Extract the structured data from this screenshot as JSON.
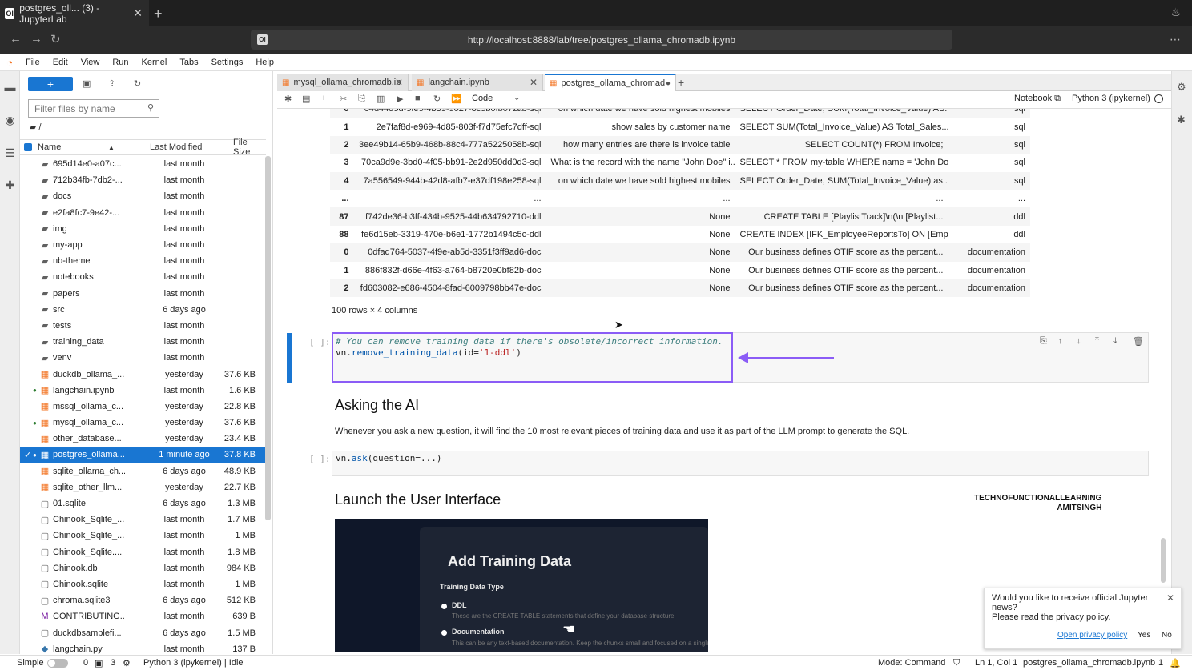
{
  "browser": {
    "tab_title": "postgres_oll... (3) - JupyterLab",
    "tab_favicon": "Ol",
    "url": "http://localhost:8888/lab/tree/postgres_ollama_chromadb.ipynb"
  },
  "menu": [
    "File",
    "Edit",
    "View",
    "Run",
    "Kernel",
    "Tabs",
    "Settings",
    "Help"
  ],
  "filebrowser": {
    "filter_placeholder": "Filter files by name",
    "breadcrumb": "/",
    "columns": {
      "name": "Name",
      "modified": "Last Modified",
      "size": "File Size"
    },
    "files": [
      {
        "icon": "folder-icon",
        "name": "695d14e0-a07c...",
        "modified": "last month",
        "size": "",
        "running": false,
        "selected": false
      },
      {
        "icon": "folder-icon",
        "name": "712b34fb-7db2-...",
        "modified": "last month",
        "size": "",
        "running": false,
        "selected": false
      },
      {
        "icon": "folder-icon",
        "name": "docs",
        "modified": "last month",
        "size": "",
        "running": false,
        "selected": false
      },
      {
        "icon": "folder-icon",
        "name": "e2fa8fc7-9e42-...",
        "modified": "last month",
        "size": "",
        "running": false,
        "selected": false
      },
      {
        "icon": "folder-icon",
        "name": "img",
        "modified": "last month",
        "size": "",
        "running": false,
        "selected": false
      },
      {
        "icon": "folder-icon",
        "name": "my-app",
        "modified": "last month",
        "size": "",
        "running": false,
        "selected": false
      },
      {
        "icon": "folder-icon",
        "name": "nb-theme",
        "modified": "last month",
        "size": "",
        "running": false,
        "selected": false
      },
      {
        "icon": "folder-icon",
        "name": "notebooks",
        "modified": "last month",
        "size": "",
        "running": false,
        "selected": false
      },
      {
        "icon": "folder-icon",
        "name": "papers",
        "modified": "last month",
        "size": "",
        "running": false,
        "selected": false
      },
      {
        "icon": "folder-icon",
        "name": "src",
        "modified": "6 days ago",
        "size": "",
        "running": false,
        "selected": false
      },
      {
        "icon": "folder-icon",
        "name": "tests",
        "modified": "last month",
        "size": "",
        "running": false,
        "selected": false
      },
      {
        "icon": "folder-icon",
        "name": "training_data",
        "modified": "last month",
        "size": "",
        "running": false,
        "selected": false
      },
      {
        "icon": "folder-icon",
        "name": "venv",
        "modified": "last month",
        "size": "",
        "running": false,
        "selected": false
      },
      {
        "icon": "notebook-icon",
        "name": "duckdb_ollama_...",
        "modified": "yesterday",
        "size": "37.6 KB",
        "running": false,
        "selected": false
      },
      {
        "icon": "notebook-icon",
        "name": "langchain.ipynb",
        "modified": "last month",
        "size": "1.6 KB",
        "running": true,
        "selected": false
      },
      {
        "icon": "notebook-icon",
        "name": "mssql_ollama_c...",
        "modified": "yesterday",
        "size": "22.8 KB",
        "running": false,
        "selected": false
      },
      {
        "icon": "notebook-icon",
        "name": "mysql_ollama_c...",
        "modified": "yesterday",
        "size": "37.6 KB",
        "running": true,
        "selected": false
      },
      {
        "icon": "notebook-icon",
        "name": "other_database...",
        "modified": "yesterday",
        "size": "23.4 KB",
        "running": false,
        "selected": false
      },
      {
        "icon": "notebook-icon",
        "name": "postgres_ollama...",
        "modified": "1 minute ago",
        "size": "37.8 KB",
        "running": true,
        "selected": true
      },
      {
        "icon": "notebook-icon",
        "name": "sqlite_ollama_ch...",
        "modified": "6 days ago",
        "size": "48.9 KB",
        "running": false,
        "selected": false
      },
      {
        "icon": "notebook-icon",
        "name": "sqlite_other_llm...",
        "modified": "yesterday",
        "size": "22.7 KB",
        "running": false,
        "selected": false
      },
      {
        "icon": "file-icon",
        "name": "01.sqlite",
        "modified": "6 days ago",
        "size": "1.3 MB",
        "running": false,
        "selected": false
      },
      {
        "icon": "file-icon",
        "name": "Chinook_Sqlite_...",
        "modified": "last month",
        "size": "1.7 MB",
        "running": false,
        "selected": false
      },
      {
        "icon": "file-icon",
        "name": "Chinook_Sqlite_...",
        "modified": "last month",
        "size": "1 MB",
        "running": false,
        "selected": false
      },
      {
        "icon": "file-icon",
        "name": "Chinook_Sqlite....",
        "modified": "last month",
        "size": "1.8 MB",
        "running": false,
        "selected": false
      },
      {
        "icon": "file-icon",
        "name": "Chinook.db",
        "modified": "last month",
        "size": "984 KB",
        "running": false,
        "selected": false
      },
      {
        "icon": "file-icon",
        "name": "Chinook.sqlite",
        "modified": "last month",
        "size": "1 MB",
        "running": false,
        "selected": false
      },
      {
        "icon": "file-icon",
        "name": "chroma.sqlite3",
        "modified": "6 days ago",
        "size": "512 KB",
        "running": false,
        "selected": false
      },
      {
        "icon": "markdown-icon",
        "name": "CONTRIBUTING....",
        "modified": "last month",
        "size": "639 B",
        "running": false,
        "selected": false
      },
      {
        "icon": "file-icon",
        "name": "duckdbsamplefi...",
        "modified": "6 days ago",
        "size": "1.5 MB",
        "running": false,
        "selected": false
      },
      {
        "icon": "python-icon",
        "name": "langchain.py",
        "modified": "last month",
        "size": "137 B",
        "running": false,
        "selected": false
      }
    ]
  },
  "notebook_tabs": [
    {
      "label": "mysql_ollama_chromadb.ip",
      "active": false,
      "modified": false
    },
    {
      "label": "langchain.ipynb",
      "active": false,
      "modified": false
    },
    {
      "label": "postgres_ollama_chromad",
      "active": true,
      "modified": true
    }
  ],
  "toolbar": {
    "cell_type": "Code",
    "notebook_label": "Notebook",
    "kernel": "Python 3 (ipykernel)"
  },
  "dataframe": {
    "rows": [
      {
        "idx": "0",
        "id": "04d44d5d-5fe5-4b39-9027-8c5b0fb07zab-sql",
        "question": "on which date we have sold highest mobiles",
        "content": "SELECT Order_Date, SUM(Total_Invoice_Value) AS...",
        "type": "sql"
      },
      {
        "idx": "1",
        "id": "2e7faf8d-e969-4d85-803f-f7d75efc7dff-sql",
        "question": "show sales by customer name",
        "content": "SELECT SUM(Total_Invoice_Value) AS Total_Sales...",
        "type": "sql"
      },
      {
        "idx": "2",
        "id": "3ee49b14-65b9-468b-88c4-777a5225058b-sql",
        "question": "how many entries are there is invoice table",
        "content": "SELECT COUNT(*) FROM Invoice;",
        "type": "sql"
      },
      {
        "idx": "3",
        "id": "70ca9d9e-3bd0-4f05-bb91-2e2d950dd0d3-sql",
        "question": "What is the record with the name \"John Doe\" i...",
        "content": "SELECT * FROM my-table WHERE name = 'John Doe'",
        "type": "sql"
      },
      {
        "idx": "4",
        "id": "7a556549-944b-42d8-afb7-e37df198e258-sql",
        "question": "on which date we have sold highest mobiles",
        "content": "SELECT Order_Date, SUM(Total_Invoice_Value) as...",
        "type": "sql"
      },
      {
        "idx": "...",
        "id": "...",
        "question": "...",
        "content": "...",
        "type": "..."
      },
      {
        "idx": "87",
        "id": "f742de36-b3ff-434b-9525-44b634792710-ddl",
        "question": "None",
        "content": "CREATE TABLE [PlaylistTrack]\\n(\\n [Playlist...",
        "type": "ddl"
      },
      {
        "idx": "88",
        "id": "fe6d15eb-3319-470e-b6e1-1772b1494c5c-ddl",
        "question": "None",
        "content": "CREATE INDEX [IFK_EmployeeReportsTo] ON [Emplo...",
        "type": "ddl"
      },
      {
        "idx": "0",
        "id": "0dfad764-5037-4f9e-ab5d-3351f3ff9ad6-doc",
        "question": "None",
        "content": "Our business defines OTIF score as the percent...",
        "type": "documentation"
      },
      {
        "idx": "1",
        "id": "886f832f-d66e-4f63-a764-b8720e0bf82b-doc",
        "question": "None",
        "content": "Our business defines OTIF score as the percent...",
        "type": "documentation"
      },
      {
        "idx": "2",
        "id": "fd603082-e686-4504-8fad-6009798bb47e-doc",
        "question": "None",
        "content": "Our business defines OTIF score as the percent...",
        "type": "documentation"
      }
    ],
    "footer": "100 rows × 4 columns"
  },
  "cells": {
    "code1_prompt": "[ ]:",
    "code1_comment": "# You can remove training data if there's obsolete/incorrect information.",
    "code1_obj": "vn.",
    "code1_fn": "remove_training_data",
    "code1_open": "(id=",
    "code1_str": "'1-ddl'",
    "code1_close": ")",
    "heading_ask": "Asking the AI",
    "para_ask": "Whenever you ask a new question, it will find the 10 most relevant pieces of training data and use it as part of the LLM prompt to generate the SQL.",
    "code2_prompt": "[ ]:",
    "code2_obj": "vn.",
    "code2_fn": "ask",
    "code2_args": "(question=...)",
    "heading_launch": "Launch the User Interface",
    "watermark_line1": "TECHNOFUNCTIONALLEARNING",
    "watermark_line2": "AMITSINGH"
  },
  "demo_image": {
    "title": "Add Training Data",
    "subtitle": "Training Data Type",
    "opt1_label": "DDL",
    "opt1_desc": "These are the CREATE TABLE statements that define your database structure.",
    "opt2_label": "Documentation",
    "opt2_desc": "This can be any text-based documentation. Keep the chunks small and focused on a single topic."
  },
  "notification": {
    "text_line1": "Would you like to receive official Jupyter",
    "text_line2": "news?",
    "text_line3": "Please read the privacy policy.",
    "link": "Open privacy policy",
    "yes": "Yes",
    "no": "No"
  },
  "statusbar": {
    "simple": "Simple",
    "terminals": "0",
    "kernels": "3",
    "kernel_status": "Python 3 (ipykernel) | Idle",
    "mode": "Mode: Command",
    "cursor": "Ln 1, Col 1",
    "filename": "postgres_ollama_chromadb.ipynb",
    "notifications": "1"
  },
  "colors": {
    "accent": "#1976d2",
    "highlight": "#8b5cf6",
    "jupyter_orange": "#f37626"
  }
}
